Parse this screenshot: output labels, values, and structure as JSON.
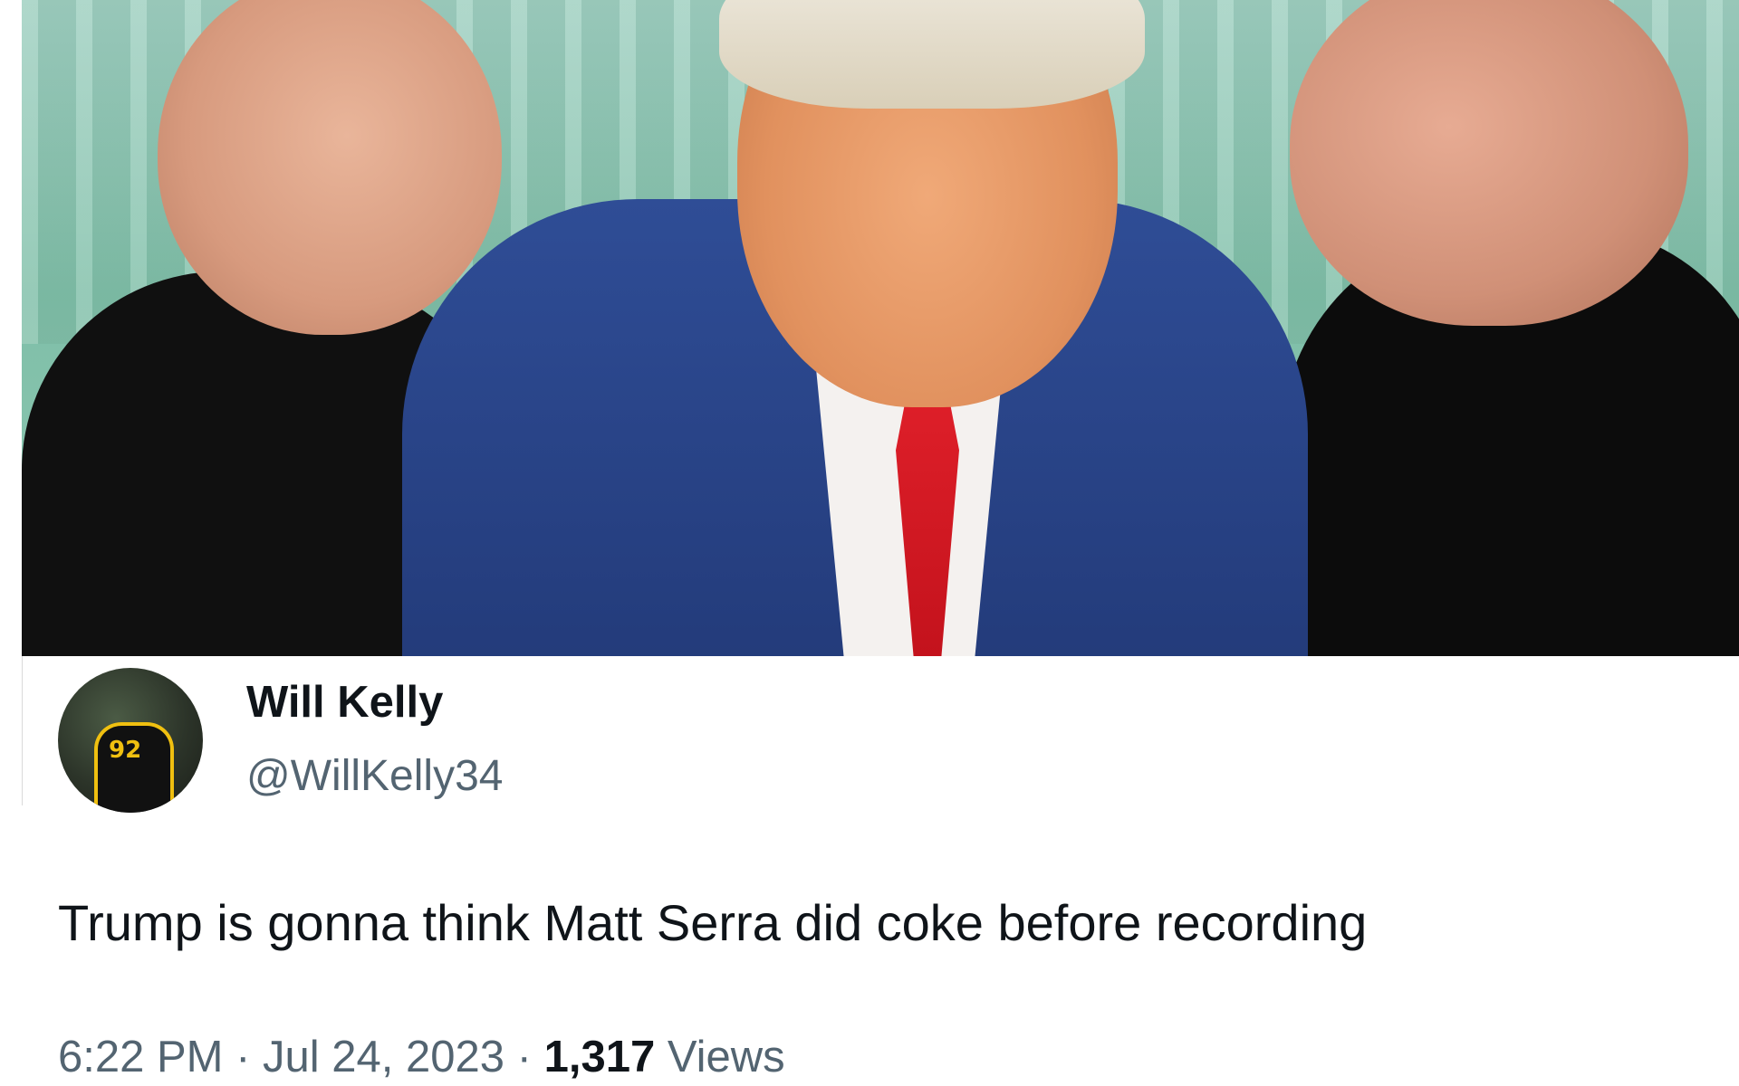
{
  "tweet": {
    "author": {
      "display_name": "Will Kelly",
      "handle": "@WillKelly34",
      "avatar_jersey_number": "92"
    },
    "text": "Trump is gonna think Matt Serra did coke before recording",
    "meta": {
      "time": "6:22 PM",
      "separator": " · ",
      "date": "Jul 24, 2023",
      "views_count": "1,317",
      "views_label": "Views"
    }
  },
  "colors": {
    "primary_text": "#0f1419",
    "secondary_text": "#536471",
    "tie_red": "#d01820",
    "suit_blue": "#2f4d96"
  }
}
